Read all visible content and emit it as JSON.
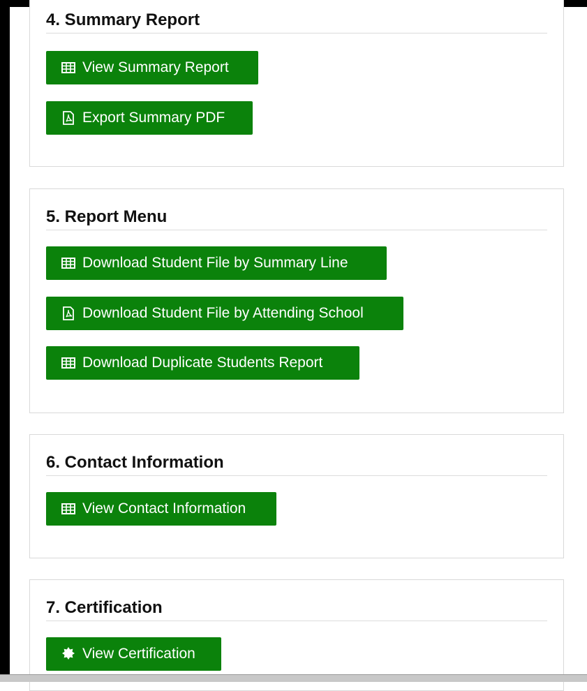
{
  "sections": [
    {
      "title": "4. Summary Report",
      "buttons": [
        {
          "label": "View Summary Report",
          "icon": "table-icon"
        },
        {
          "label": "Export Summary PDF",
          "icon": "pdf-icon"
        }
      ]
    },
    {
      "title": "5. Report Menu",
      "buttons": [
        {
          "label": "Download Student File by Summary Line",
          "icon": "table-icon"
        },
        {
          "label": "Download Student File by Attending School",
          "icon": "pdf-icon"
        },
        {
          "label": "Download Duplicate Students Report",
          "icon": "table-icon"
        }
      ]
    },
    {
      "title": "6. Contact Information",
      "buttons": [
        {
          "label": "View Contact Information",
          "icon": "table-icon"
        }
      ]
    },
    {
      "title": "7. Certification",
      "buttons": [
        {
          "label": "View Certification",
          "icon": "certificate-icon"
        }
      ]
    }
  ],
  "colors": {
    "button_bg": "#0b820b",
    "button_text": "#ffffff"
  }
}
